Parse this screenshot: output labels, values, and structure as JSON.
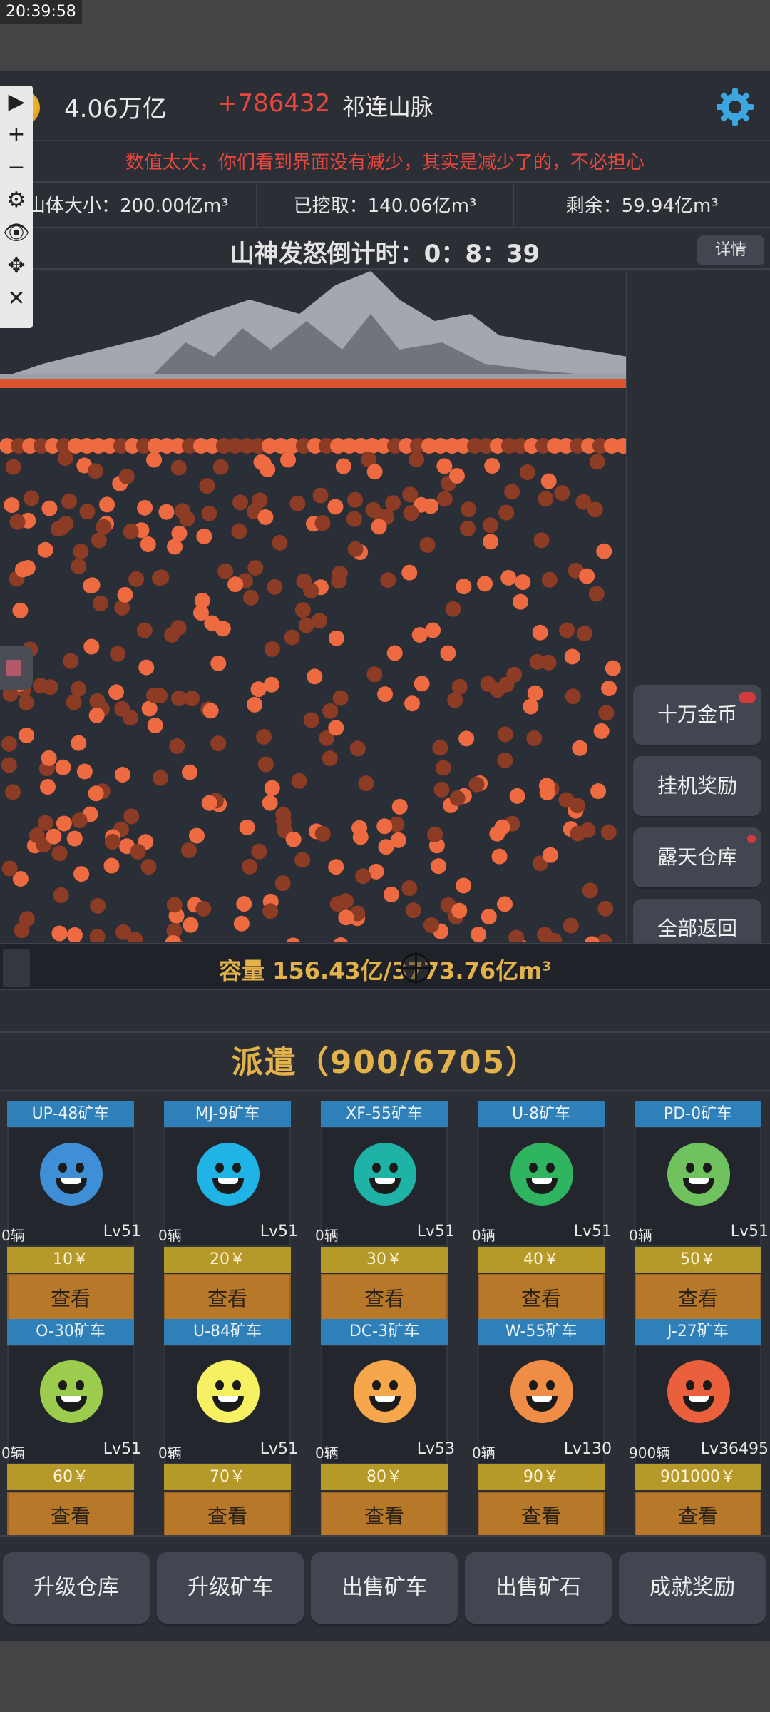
{
  "status_bar": {
    "time": "20:39:58"
  },
  "header": {
    "gold": "4.06万亿",
    "income": "+786432",
    "mountain_name": "祁连山脉"
  },
  "notice": "数值太大，你们看到界面没有减少，其实是减少了的，不必担心",
  "stats": {
    "size": "山体大小：200.00亿m³",
    "mined": "已挖取：140.06亿m³",
    "remaining": "剩余：59.94亿m³"
  },
  "countdown": {
    "text": "山神发怒倒计时：0：8：39",
    "details": "详情"
  },
  "toolbar": {
    "play": "▶",
    "zoom_in": "+",
    "zoom_out": "−",
    "settings": "⚙",
    "hide": "👁",
    "move": "✥",
    "close": "✕"
  },
  "side_buttons": [
    "十万金币",
    "挂机奖励",
    "露天仓库",
    "全部返回"
  ],
  "capacity": {
    "label": "容量",
    "value": "156.43亿/3773.76亿m",
    "unit_sup": "3"
  },
  "dispatch": {
    "title": "派遣（900/6705）"
  },
  "trucks": [
    {
      "name": "UP-48矿车",
      "count": "0辆",
      "level": "Lv51",
      "price": "10￥",
      "view": "查看",
      "color": "#3f8fd6"
    },
    {
      "name": "MJ-9矿车",
      "count": "0辆",
      "level": "Lv51",
      "price": "20￥",
      "view": "查看",
      "color": "#1fb3e6"
    },
    {
      "name": "XF-55矿车",
      "count": "0辆",
      "level": "Lv51",
      "price": "30￥",
      "view": "查看",
      "color": "#1eb3a6"
    },
    {
      "name": "U-8矿车",
      "count": "0辆",
      "level": "Lv51",
      "price": "40￥",
      "view": "查看",
      "color": "#2fb45f"
    },
    {
      "name": "PD-0矿车",
      "count": "0辆",
      "level": "Lv51",
      "price": "50￥",
      "view": "查看",
      "color": "#6fc25e"
    },
    {
      "name": "O-30矿车",
      "count": "0辆",
      "level": "Lv51",
      "price": "60￥",
      "view": "查看",
      "color": "#9ccc4e"
    },
    {
      "name": "U-84矿车",
      "count": "0辆",
      "level": "Lv51",
      "price": "70￥",
      "view": "查看",
      "color": "#f6f063"
    },
    {
      "name": "DC-3矿车",
      "count": "0辆",
      "level": "Lv53",
      "price": "80￥",
      "view": "查看",
      "color": "#f7a74b"
    },
    {
      "name": "W-55矿车",
      "count": "0辆",
      "level": "Lv130",
      "price": "90￥",
      "view": "查看",
      "color": "#ef8c45"
    },
    {
      "name": "J-27矿车",
      "count": "900辆",
      "level": "Lv36495",
      "price": "901000￥",
      "view": "查看",
      "color": "#ea5f3c"
    }
  ],
  "bottom_buttons": [
    "升级仓库",
    "升级矿车",
    "出售矿车",
    "出售矿石",
    "成就奖励"
  ],
  "colors": {
    "accent_gold": "#e3b24a",
    "alert_red": "#e8473e",
    "miner_orange": "#ee6a40"
  }
}
